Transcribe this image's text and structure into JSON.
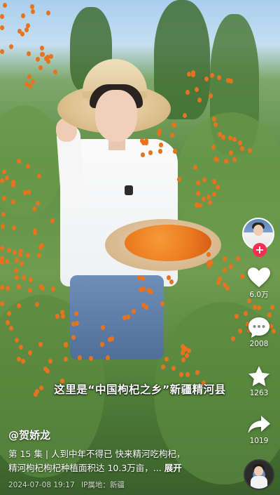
{
  "subtitle": "这里是“中国枸杞之乡”新疆精河县",
  "actions": {
    "like_count": "6.0万",
    "comment_count": "2008",
    "favorite_count": "1263",
    "share_count": "1019"
  },
  "author": {
    "handle": "@贺娇龙"
  },
  "description": {
    "episode": "第 15 集",
    "separator": "|",
    "text_line1": "人到中年不得已 快来精河吃枸杞，",
    "text_line2": "精河枸杞枸杞种植面积达 10.3万亩，...",
    "expand_label": "展开"
  },
  "meta": {
    "date": "2024-07-08 19:17",
    "ip_location": "IP属地：新疆"
  },
  "icons": {
    "like": "heart-icon",
    "comment": "comment-bubble-icon",
    "favorite": "star-icon",
    "share": "share-arrow-icon",
    "follow": "plus-icon"
  },
  "colors": {
    "follow_red": "#fe2c55",
    "berry_orange": "#e8731e"
  }
}
